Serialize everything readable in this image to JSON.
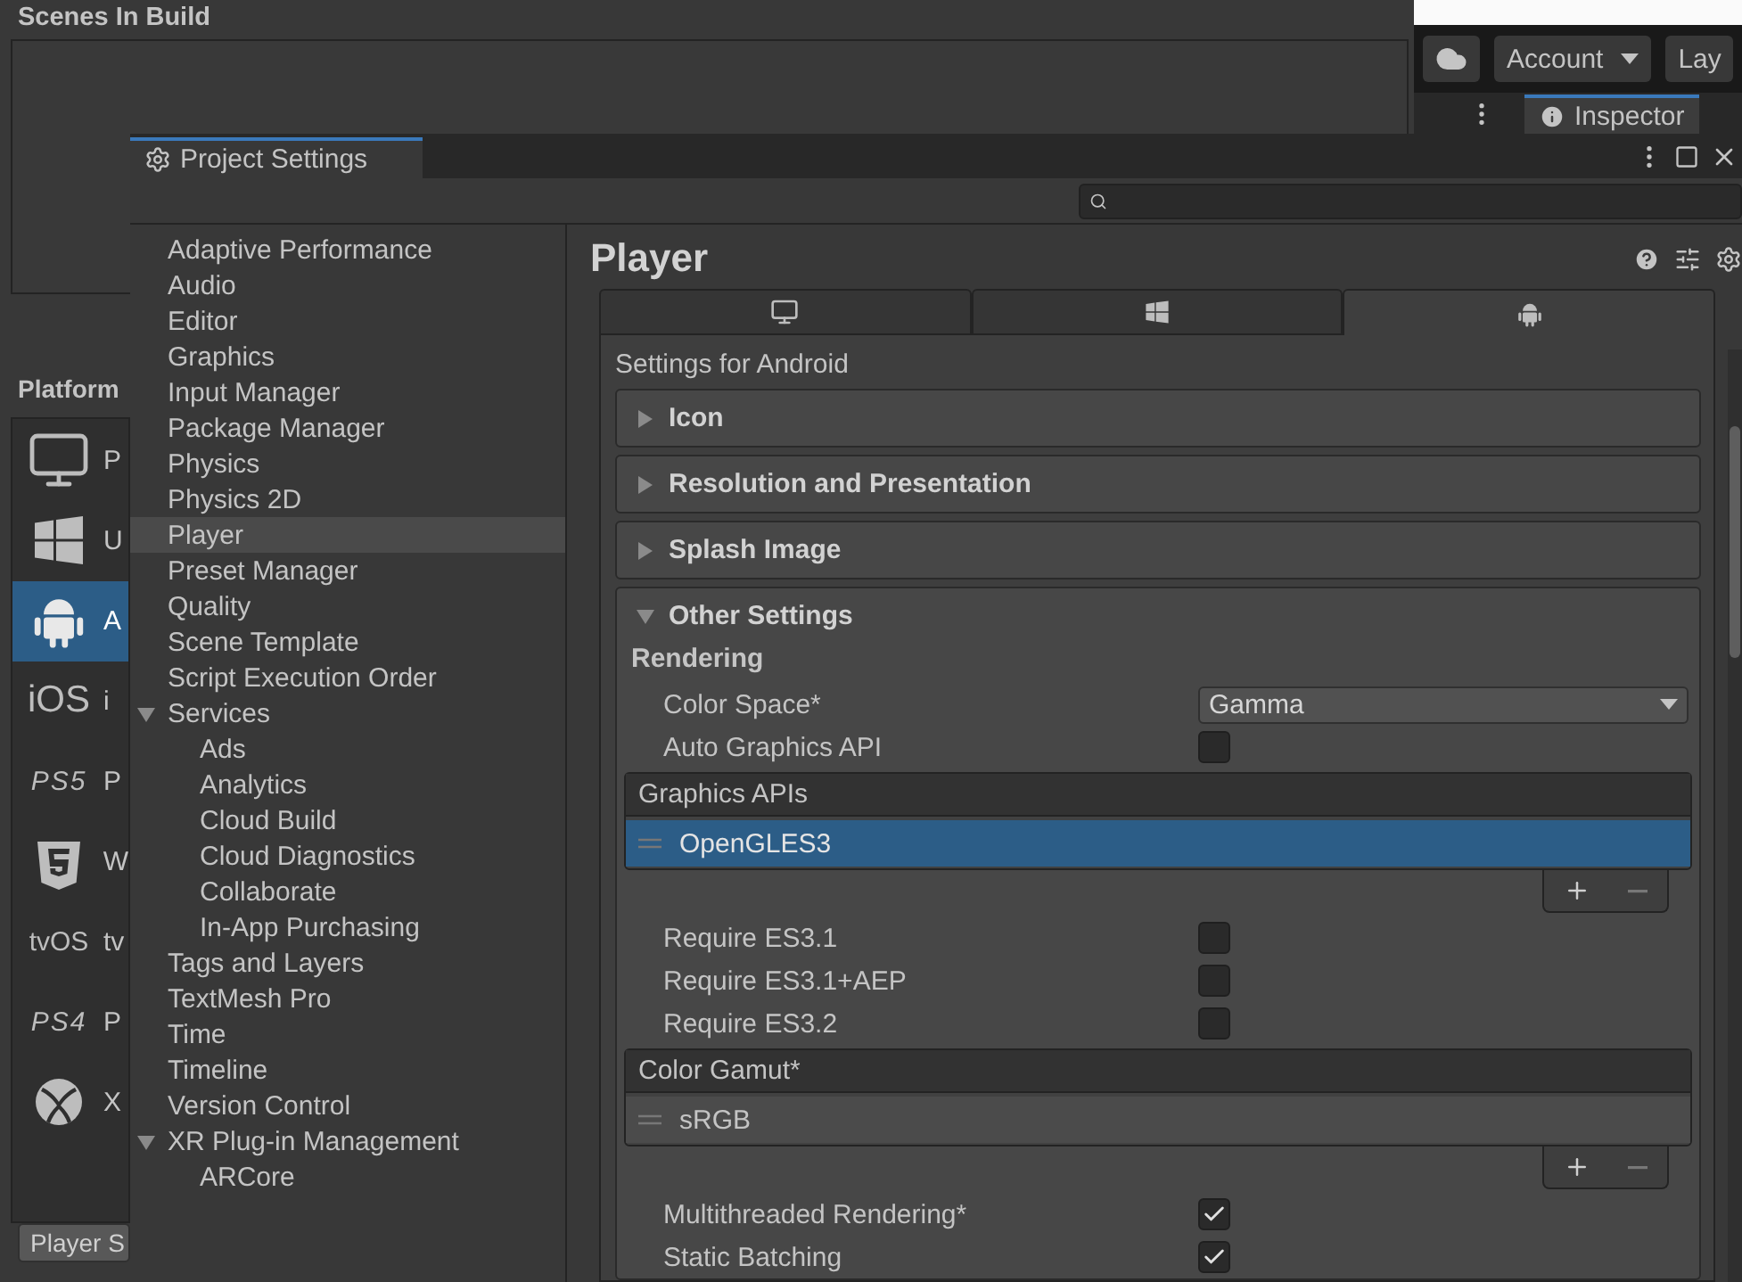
{
  "build_settings": {
    "scenes_title": "Scenes In Build",
    "platform_title": "Platform",
    "platforms": [
      {
        "kind": "monitor",
        "label": "P",
        "selected": false
      },
      {
        "kind": "windows",
        "label": "U",
        "selected": false
      },
      {
        "kind": "android",
        "label": "A",
        "selected": true
      },
      {
        "kind": "logo",
        "logo": "iOS",
        "label": "i",
        "selected": false
      },
      {
        "kind": "logo",
        "logo": "PS5",
        "label": "P",
        "selected": false
      },
      {
        "kind": "html5",
        "label": "W",
        "selected": false
      },
      {
        "kind": "logo",
        "logo": "tvOS",
        "label": "tv",
        "selected": false
      },
      {
        "kind": "logo",
        "logo": "PS4",
        "label": "P",
        "selected": false
      },
      {
        "kind": "xbox",
        "label": "X",
        "selected": false
      }
    ],
    "button": "Player S"
  },
  "toolbar": {
    "account": "Account",
    "layout": "Lay"
  },
  "inspector_tab": {
    "label": "Inspector"
  },
  "project_settings": {
    "title": "Project Settings",
    "categories": [
      {
        "label": "Adaptive Performance",
        "selected": false
      },
      {
        "label": "Audio",
        "selected": false
      },
      {
        "label": "Editor",
        "selected": false
      },
      {
        "label": "Graphics",
        "selected": false
      },
      {
        "label": "Input Manager",
        "selected": false
      },
      {
        "label": "Package Manager",
        "selected": false
      },
      {
        "label": "Physics",
        "selected": false
      },
      {
        "label": "Physics 2D",
        "selected": false
      },
      {
        "label": "Player",
        "selected": true
      },
      {
        "label": "Preset Manager",
        "selected": false
      },
      {
        "label": "Quality",
        "selected": false
      },
      {
        "label": "Scene Template",
        "selected": false
      },
      {
        "label": "Script Execution Order",
        "selected": false
      },
      {
        "label": "Services",
        "selected": false,
        "expanded": true,
        "children": [
          {
            "label": "Ads",
            "selected": false
          },
          {
            "label": "Analytics",
            "selected": false
          },
          {
            "label": "Cloud Build",
            "selected": false
          },
          {
            "label": "Cloud Diagnostics",
            "selected": false
          },
          {
            "label": "Collaborate",
            "selected": false
          },
          {
            "label": "In-App Purchasing",
            "selected": false
          }
        ]
      },
      {
        "label": "Tags and Layers",
        "selected": false
      },
      {
        "label": "TextMesh Pro",
        "selected": false
      },
      {
        "label": "Time",
        "selected": false
      },
      {
        "label": "Timeline",
        "selected": false
      },
      {
        "label": "Version Control",
        "selected": false
      },
      {
        "label": "XR Plug-in Management",
        "selected": false,
        "expanded": true,
        "children": [
          {
            "label": "ARCore",
            "selected": false
          }
        ]
      }
    ],
    "page": {
      "title": "Player",
      "platform_tabs": [
        {
          "kind": "desktop",
          "selected": false
        },
        {
          "kind": "windows",
          "selected": false
        },
        {
          "kind": "android",
          "selected": true
        }
      ],
      "settings_for": "Settings for Android",
      "sections": [
        {
          "title": "Icon",
          "expanded": false
        },
        {
          "title": "Resolution and Presentation",
          "expanded": false
        },
        {
          "title": "Splash Image",
          "expanded": false
        },
        {
          "title": "Other Settings",
          "expanded": true
        }
      ],
      "group": "Rendering",
      "rows": [
        {
          "kind": "dropdown",
          "label": "Color Space*",
          "value": "Gamma"
        },
        {
          "kind": "checkbox",
          "label": "Auto Graphics API",
          "checked": false
        },
        {
          "kind": "list",
          "header": "Graphics APIs",
          "items": [
            {
              "label": "OpenGLES3",
              "selected": true
            }
          ]
        },
        {
          "kind": "checkbox",
          "label": "Require ES3.1",
          "checked": false
        },
        {
          "kind": "checkbox",
          "label": "Require ES3.1+AEP",
          "checked": false
        },
        {
          "kind": "checkbox",
          "label": "Require ES3.2",
          "checked": false
        },
        {
          "kind": "list",
          "header": "Color Gamut*",
          "items": [
            {
              "label": "sRGB",
              "selected": false
            }
          ]
        },
        {
          "kind": "checkbox",
          "label": "Multithreaded Rendering*",
          "checked": true
        },
        {
          "kind": "checkbox",
          "label": "Static Batching",
          "checked": true
        }
      ]
    }
  }
}
